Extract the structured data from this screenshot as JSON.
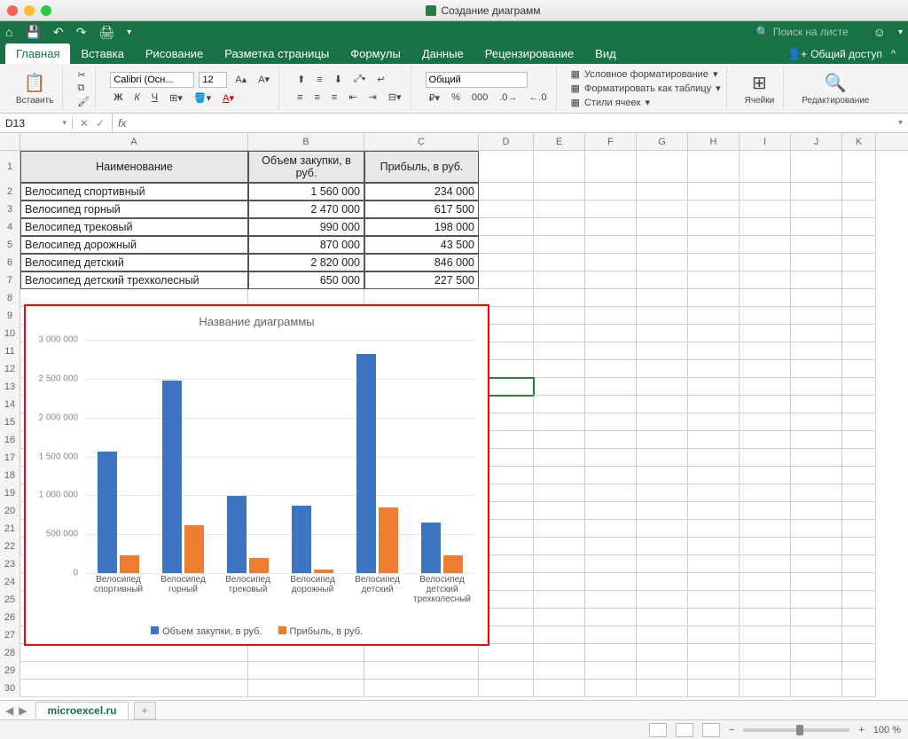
{
  "window": {
    "title": "Создание диаграмм"
  },
  "quick_search_placeholder": "Поиск на листе",
  "tabs": {
    "items": [
      "Главная",
      "Вставка",
      "Рисование",
      "Разметка страницы",
      "Формулы",
      "Данные",
      "Рецензирование",
      "Вид"
    ],
    "share": "Общий доступ"
  },
  "ribbon": {
    "paste": "Вставить",
    "font_name": "Calibri (Осн...",
    "font_size": "12",
    "number_format": "Общий",
    "cond_fmt": "Условное форматирование",
    "fmt_table": "Форматировать как таблицу",
    "cell_styles": "Стили ячеек",
    "cells": "Ячейки",
    "editing": "Редактирование"
  },
  "namebox": "D13",
  "columns": [
    "A",
    "B",
    "C",
    "D",
    "E",
    "F",
    "G",
    "H",
    "I",
    "J",
    "K"
  ],
  "table": {
    "headers": [
      "Наименование",
      "Объем закупки, в руб.",
      "Прибыль, в руб."
    ],
    "rows": [
      [
        "Велосипед спортивный",
        "1 560 000",
        "234 000"
      ],
      [
        "Велосипед горный",
        "2 470 000",
        "617 500"
      ],
      [
        "Велосипед трековый",
        "990 000",
        "198 000"
      ],
      [
        "Велосипед дорожный",
        "870 000",
        "43 500"
      ],
      [
        "Велосипед детский",
        "2 820 000",
        "846 000"
      ],
      [
        "Велосипед детский трехколесный",
        "650 000",
        "227 500"
      ]
    ]
  },
  "chart_data": {
    "type": "bar",
    "title": "Название диаграммы",
    "categories": [
      "Велосипед спортивный",
      "Велосипед горный",
      "Велосипед трековый",
      "Велосипед дорожный",
      "Велосипед детский",
      "Велосипед детский трехколесный"
    ],
    "series": [
      {
        "name": "Объем закупки, в руб.",
        "values": [
          1560000,
          2470000,
          990000,
          870000,
          2820000,
          650000
        ],
        "color": "#3e75c2"
      },
      {
        "name": "Прибыль, в руб.",
        "values": [
          234000,
          617500,
          198000,
          43500,
          846000,
          227500
        ],
        "color": "#ed7d31"
      }
    ],
    "ylim": [
      0,
      3000000
    ],
    "yticks": [
      0,
      500000,
      1000000,
      1500000,
      2000000,
      2500000,
      3000000
    ],
    "ytick_labels": [
      "0",
      "500 000",
      "1 000 000",
      "1 500 000",
      "2 000 000",
      "2 500 000",
      "3 000 000"
    ]
  },
  "sheet": {
    "name": "microexcel.ru"
  },
  "status": {
    "zoom": "100 %"
  }
}
